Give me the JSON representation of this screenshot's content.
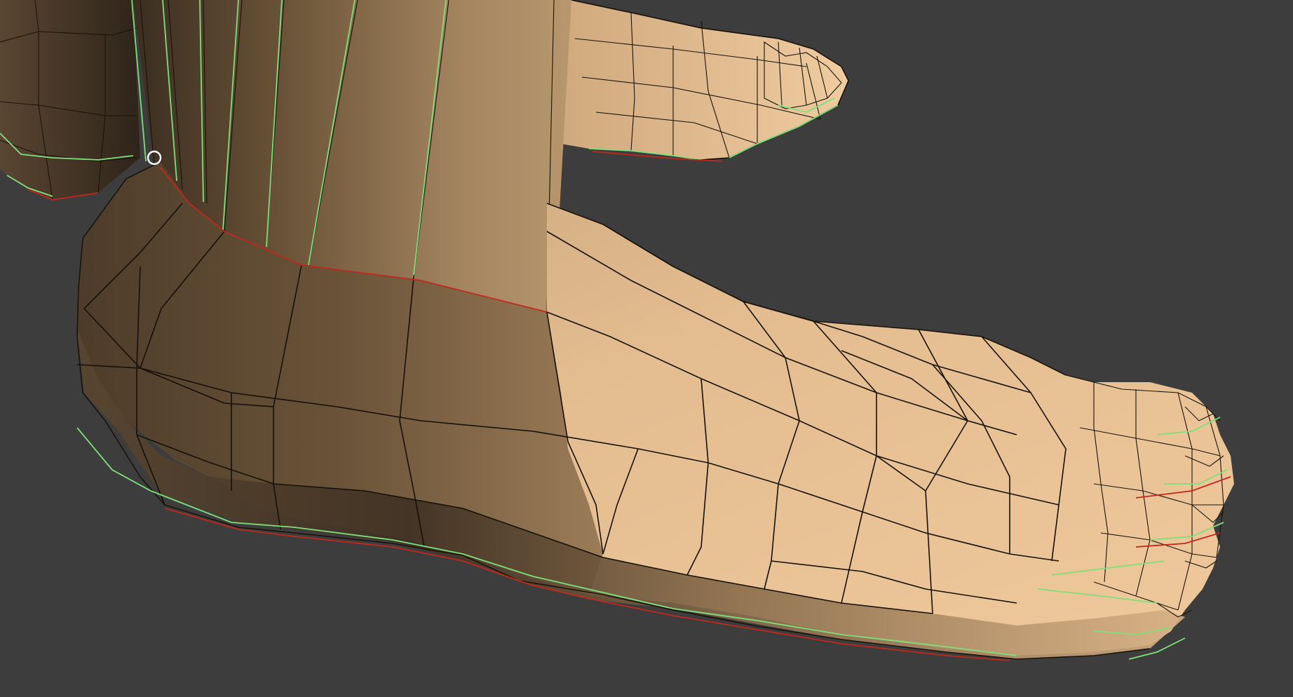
{
  "viewport": {
    "background_color": "#3d3d3d",
    "skin_light": "#e9c497",
    "skin_mid": "#b89068",
    "skin_dark": "#4a3a28",
    "wire_color": "#151008",
    "seam_green": "#7ee07a",
    "seam_red": "#c0281e"
  },
  "gizmo": {
    "icon": "vertex-selection-circle-icon"
  }
}
